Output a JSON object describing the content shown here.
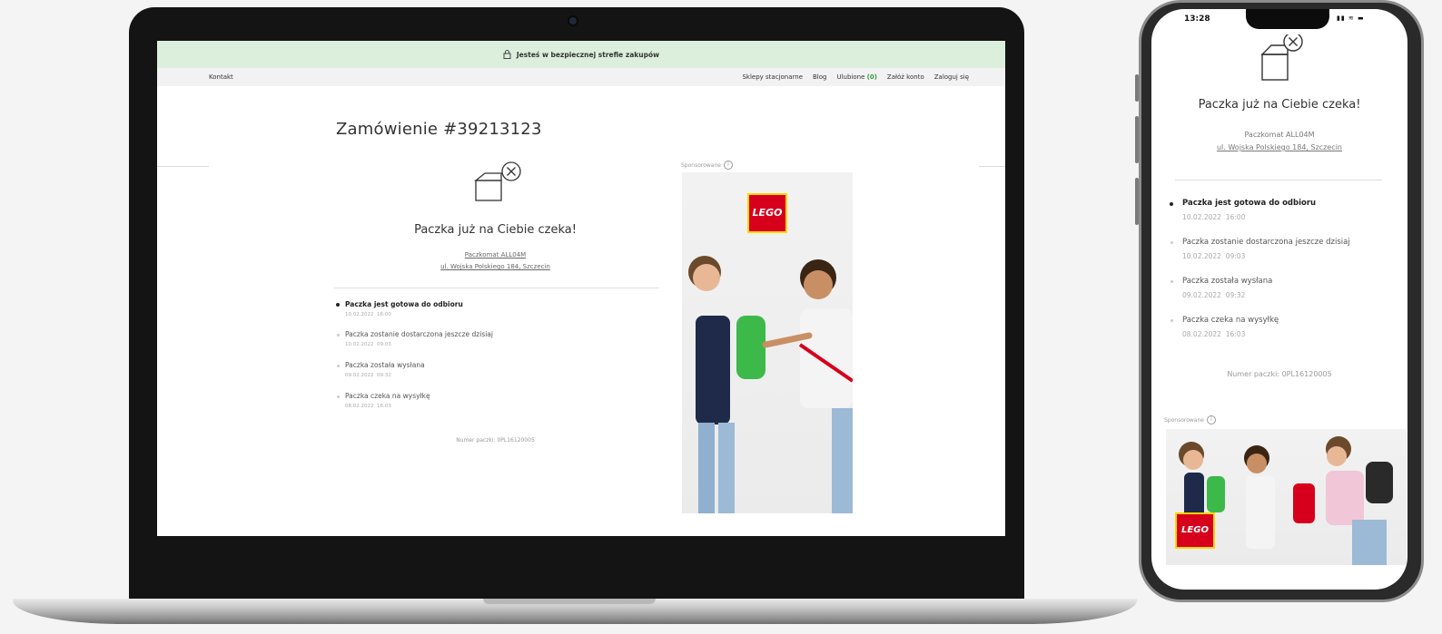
{
  "secure_bar": {
    "text": "Jesteś w bezpiecznej strefie zakupów"
  },
  "nav": {
    "contact": "Kontakt",
    "stores": "Sklepy stacjonarne",
    "blog": "Blog",
    "favorites": "Ulubione",
    "favorites_count": "(0)",
    "register": "Załóż konto",
    "login": "Zaloguj się"
  },
  "order": {
    "title": "Zamówienie #39213123"
  },
  "package": {
    "heading": "Paczka już na Ciebie czeka!",
    "locker": "Paczkomat ALL04M",
    "address": "ul. Wojska Polskiego 184, Szczecin"
  },
  "timeline": [
    {
      "label": "Paczka jest gotowa do odbioru",
      "date": "10.02.2022",
      "time": "16:00",
      "active": true
    },
    {
      "label": "Paczka zostanie dostarczona jeszcze dzisiaj",
      "date": "10.02.2022",
      "time": "09:03",
      "active": false
    },
    {
      "label": "Paczka została wysłana",
      "date": "09.02.2022",
      "time": "09:32",
      "active": false
    },
    {
      "label": "Paczka czeka na wysyłkę",
      "date": "08.02.2022",
      "time": "16:03",
      "active": false
    }
  ],
  "parcel_number": "Numer paczki: 0PL16120005",
  "sponsored": "Sponsorowane",
  "ad": {
    "brand": "LEGO"
  },
  "phone": {
    "time": "13:28",
    "status_icons": "▮▮ ≋ ▬"
  },
  "colors": {
    "secure_bar_bg": "#dcefdc",
    "favorites_green": "#2e9e3e",
    "lego_red": "#d6001c",
    "lego_yellow": "#ffd500"
  }
}
